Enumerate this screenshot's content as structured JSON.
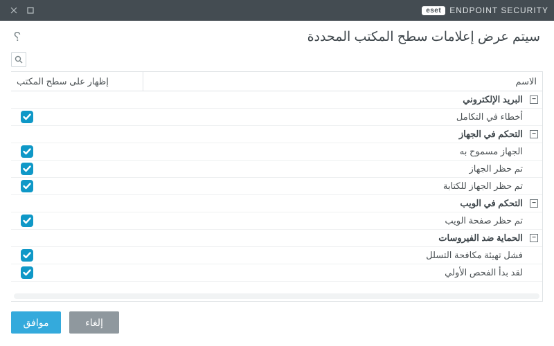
{
  "brand": {
    "badge": "eset",
    "product": "ENDPOINT SECURITY"
  },
  "header": {
    "title": "سيتم عرض إعلامات سطح المكتب المحددة"
  },
  "table": {
    "columns": {
      "name": "الاسم",
      "show": "إظهار على سطح المكتب"
    }
  },
  "groups": [
    {
      "label": "البريد الإلكتروني",
      "items": [
        {
          "label": "أخطاء في التكامل",
          "checked": true
        }
      ]
    },
    {
      "label": "التحكم في الجهاز",
      "items": [
        {
          "label": "الجهاز مسموح به",
          "checked": true
        },
        {
          "label": "تم حظر الجهاز",
          "checked": true
        },
        {
          "label": "تم حظر الجهاز للكتابة",
          "checked": true
        }
      ]
    },
    {
      "label": "التحكم في الويب",
      "items": [
        {
          "label": "تم حظر صفحة الويب",
          "checked": true
        }
      ]
    },
    {
      "label": "الحماية ضد الفيروسات",
      "items": [
        {
          "label": "فشل تهيئة مكافحة التسلل",
          "checked": true
        },
        {
          "label": "لقد بدأ الفحص الأولي",
          "checked": true
        }
      ]
    }
  ],
  "footer": {
    "ok": "موافق",
    "cancel": "إلغاء"
  }
}
